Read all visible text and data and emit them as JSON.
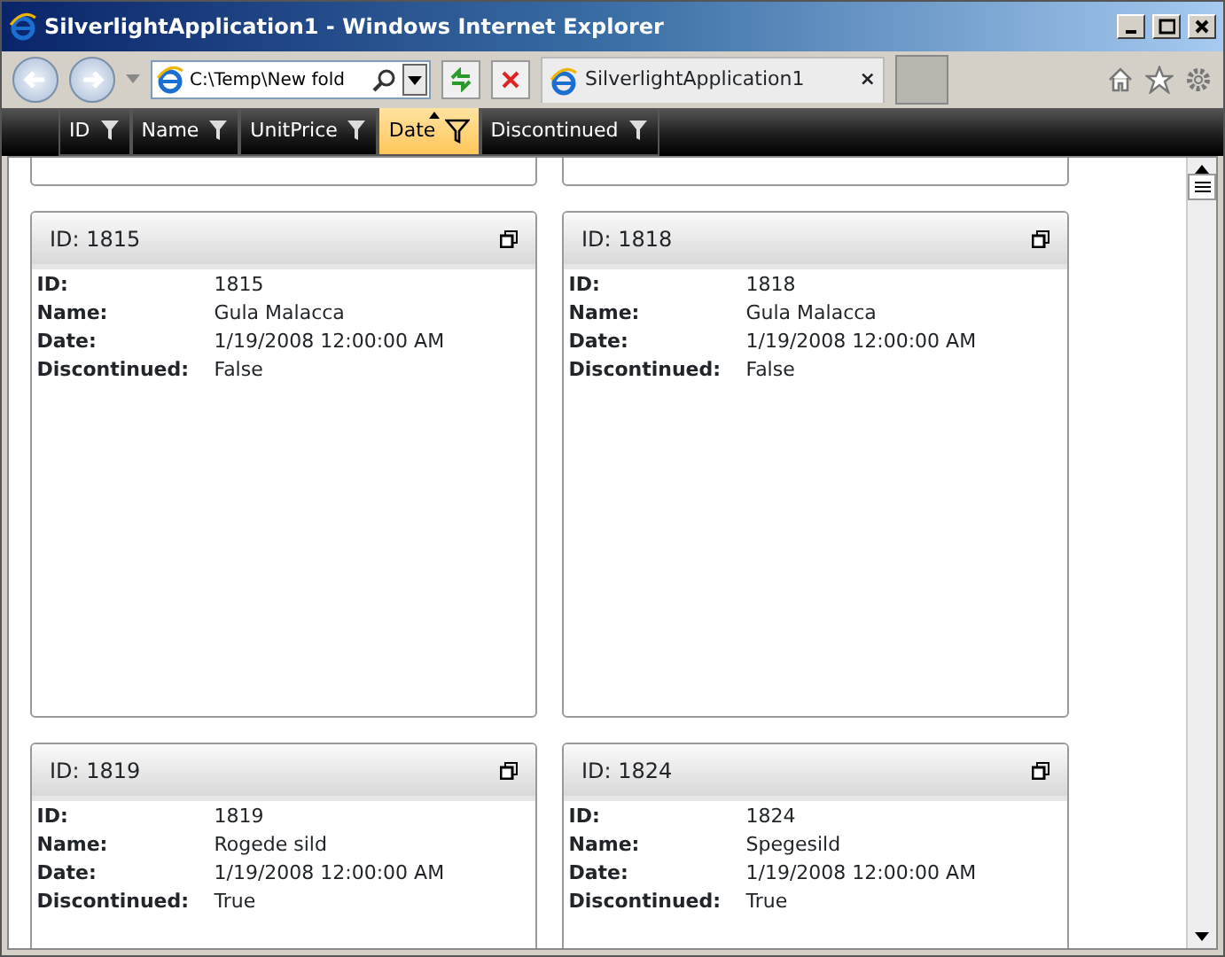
{
  "window": {
    "title": "SilverlightApplication1 - Windows Internet Explorer"
  },
  "address_bar": {
    "value": "C:\\Temp\\New fold"
  },
  "tab": {
    "title": "SilverlightApplication1",
    "close": "×"
  },
  "columns": [
    {
      "label": "ID",
      "selected": false
    },
    {
      "label": "Name",
      "selected": false
    },
    {
      "label": "UnitPrice",
      "selected": false
    },
    {
      "label": "Date",
      "selected": true
    },
    {
      "label": "Discontinued",
      "selected": false
    }
  ],
  "cards": [
    {
      "title": "ID: 1815",
      "fields": [
        {
          "label": "ID:",
          "value": "1815"
        },
        {
          "label": "Name:",
          "value": "Gula Malacca"
        },
        {
          "label": "Date:",
          "value": "1/19/2008 12:00:00 AM"
        },
        {
          "label": "Discontinued:",
          "value": "False"
        }
      ]
    },
    {
      "title": "ID: 1818",
      "fields": [
        {
          "label": "ID:",
          "value": "1818"
        },
        {
          "label": "Name:",
          "value": "Gula Malacca"
        },
        {
          "label": "Date:",
          "value": "1/19/2008 12:00:00 AM"
        },
        {
          "label": "Discontinued:",
          "value": "False"
        }
      ]
    },
    {
      "title": "ID: 1819",
      "fields": [
        {
          "label": "ID:",
          "value": "1819"
        },
        {
          "label": "Name:",
          "value": "Rogede sild"
        },
        {
          "label": "Date:",
          "value": "1/19/2008 12:00:00 AM"
        },
        {
          "label": "Discontinued:",
          "value": "True"
        }
      ]
    },
    {
      "title": "ID: 1824",
      "fields": [
        {
          "label": "ID:",
          "value": "1824"
        },
        {
          "label": "Name:",
          "value": "Spegesild"
        },
        {
          "label": "Date:",
          "value": "1/19/2008 12:00:00 AM"
        },
        {
          "label": "Discontinued:",
          "value": "True"
        }
      ]
    }
  ]
}
